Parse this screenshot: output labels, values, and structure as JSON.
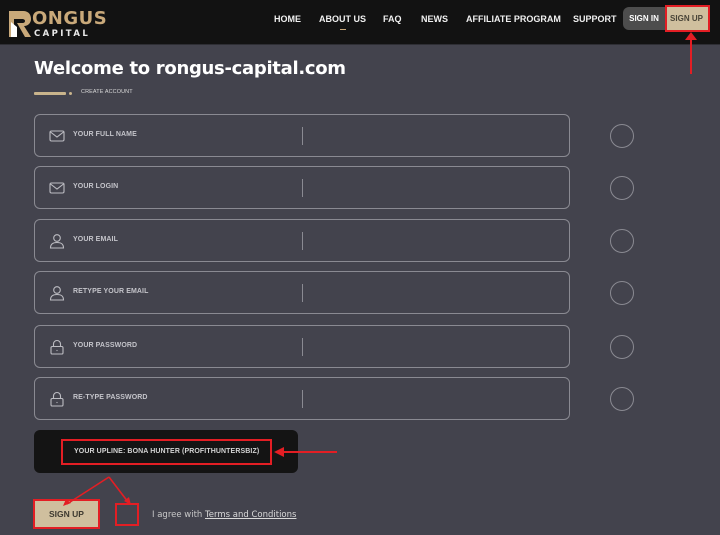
{
  "header": {
    "logo": {
      "brand": "ONGUS",
      "sub": "CAPITAL",
      "accent_color": "#c9a97a"
    },
    "nav": [
      {
        "label": "HOME",
        "active": false
      },
      {
        "label": "ABOUT US",
        "active": true
      },
      {
        "label": "FAQ",
        "active": false
      },
      {
        "label": "NEWS",
        "active": false
      },
      {
        "label": "AFFILIATE PROGRAM",
        "active": false
      },
      {
        "label": "SUPPORT",
        "active": false
      }
    ],
    "sign_in_label": "SIGN IN",
    "sign_up_label": "SIGN UP"
  },
  "page": {
    "title": "Welcome to rongus-capital.com",
    "breadcrumb": "CREATE ACCOUNT"
  },
  "form": {
    "fields": [
      {
        "label": "YOUR FULL NAME",
        "icon": "envelope-icon",
        "value": ""
      },
      {
        "label": "YOUR LOGIN",
        "icon": "envelope-icon",
        "value": ""
      },
      {
        "label": "YOUR EMAIL",
        "icon": "user-icon",
        "value": ""
      },
      {
        "label": "RETYPE YOUR EMAIL",
        "icon": "user-icon",
        "value": ""
      },
      {
        "label": "YOUR PASSWORD",
        "icon": "lock-icon",
        "value": ""
      },
      {
        "label": "RE-TYPE PASSWORD",
        "icon": "lock-icon",
        "value": ""
      }
    ],
    "upline": "YOUR UPLINE:  BONA HUNTER (PROFITHUNTERSBIZ)",
    "submit_label": "SIGN UP",
    "agree_prefix": "I agree with ",
    "agree_link": "Terms and Conditions"
  },
  "annotations": {
    "highlight_color": "#e31e24"
  }
}
